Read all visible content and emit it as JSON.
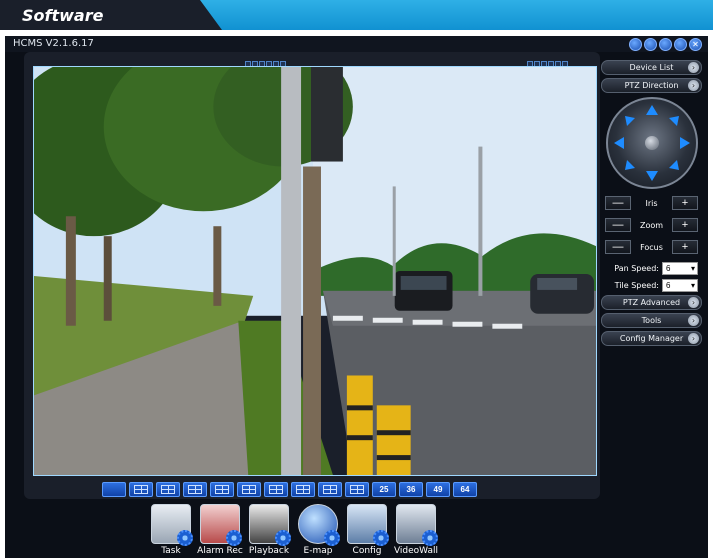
{
  "banner": {
    "title": "Software"
  },
  "app": {
    "title": "HCMS V2.1.6.17"
  },
  "layout_buttons": [
    "",
    "",
    "",
    "",
    "",
    "",
    "",
    "",
    "",
    "",
    "25",
    "36",
    "49",
    "64"
  ],
  "dock": [
    {
      "label": "Task",
      "icon": "camera-icon"
    },
    {
      "label": "Alarm Rec",
      "icon": "alarm-icon"
    },
    {
      "label": "Playback",
      "icon": "clapper-icon"
    },
    {
      "label": "E-map",
      "icon": "globe-icon"
    },
    {
      "label": "Config",
      "icon": "config-icon"
    },
    {
      "label": "VideoWall",
      "icon": "videowall-icon"
    }
  ],
  "panel": {
    "device_list": "Device List",
    "ptz_direction": "PTZ Direction",
    "iris": "Iris",
    "zoom": "Zoom",
    "focus": "Focus",
    "pan_speed_label": "Pan Speed:",
    "pan_speed_value": "6",
    "tile_speed_label": "Tile Speed:",
    "tile_speed_value": "6",
    "ptz_advanced": "PTZ Advanced",
    "tools": "Tools",
    "config_manager": "Config Manager",
    "minus": "—",
    "plus": "+"
  },
  "colors": {
    "banner": "#1fa3e0",
    "accent": "#2d6fe0",
    "background": "#0b0f17"
  }
}
